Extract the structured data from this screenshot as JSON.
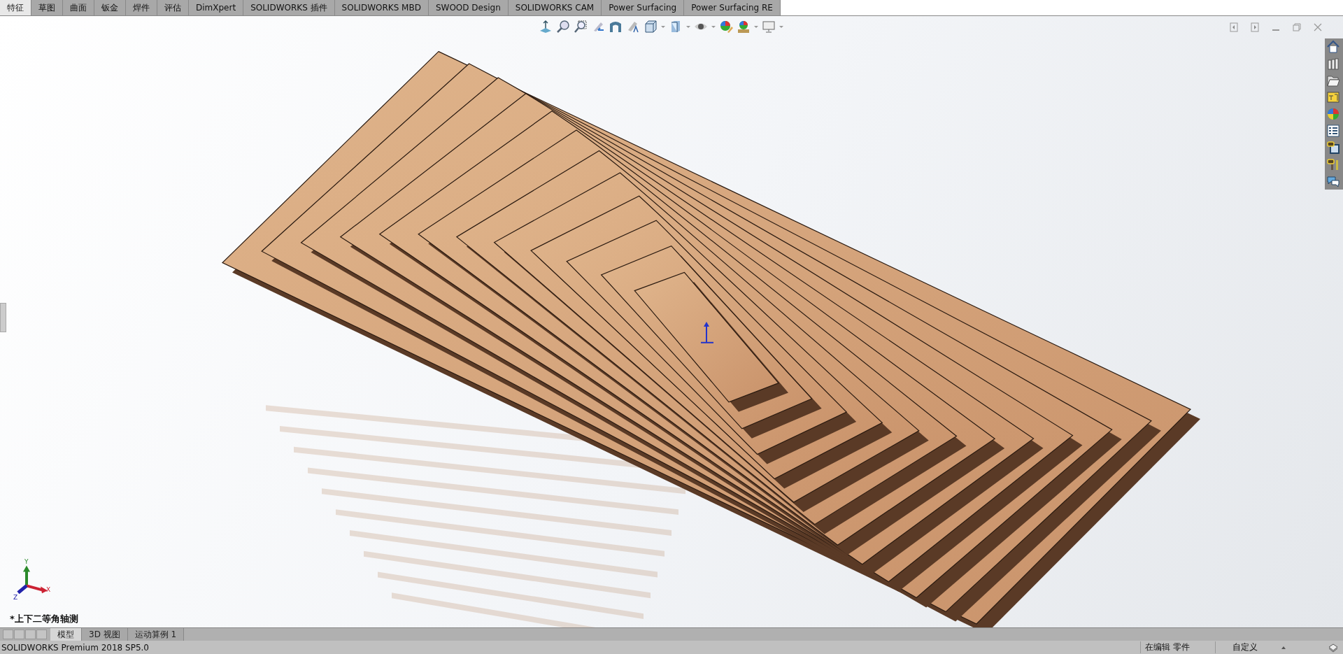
{
  "command_tabs": [
    {
      "label": "特征",
      "selected": true
    },
    {
      "label": "草图",
      "selected": false
    },
    {
      "label": "曲面",
      "selected": false
    },
    {
      "label": "钣金",
      "selected": false
    },
    {
      "label": "焊件",
      "selected": false
    },
    {
      "label": "评估",
      "selected": false
    },
    {
      "label": "DimXpert",
      "selected": false
    },
    {
      "label": "SOLIDWORKS 插件",
      "selected": false
    },
    {
      "label": "SOLIDWORKS MBD",
      "selected": false
    },
    {
      "label": "SWOOD Design",
      "selected": false
    },
    {
      "label": "SOLIDWORKS CAM",
      "selected": false
    },
    {
      "label": "Power Surfacing",
      "selected": false
    },
    {
      "label": "Power Surfacing RE",
      "selected": false
    }
  ],
  "triad": {
    "x": "X",
    "y": "Y",
    "z": "Z"
  },
  "view_label": "*上下二等角轴测",
  "bottom_tabs": [
    {
      "label": "模型",
      "selected": true
    },
    {
      "label": "3D 视图",
      "selected": false
    },
    {
      "label": "运动算例 1",
      "selected": false
    }
  ],
  "status_bar": {
    "product": "SOLIDWORKS Premium 2018 SP5.0",
    "mode": "在编辑 零件",
    "units": "自定义"
  }
}
